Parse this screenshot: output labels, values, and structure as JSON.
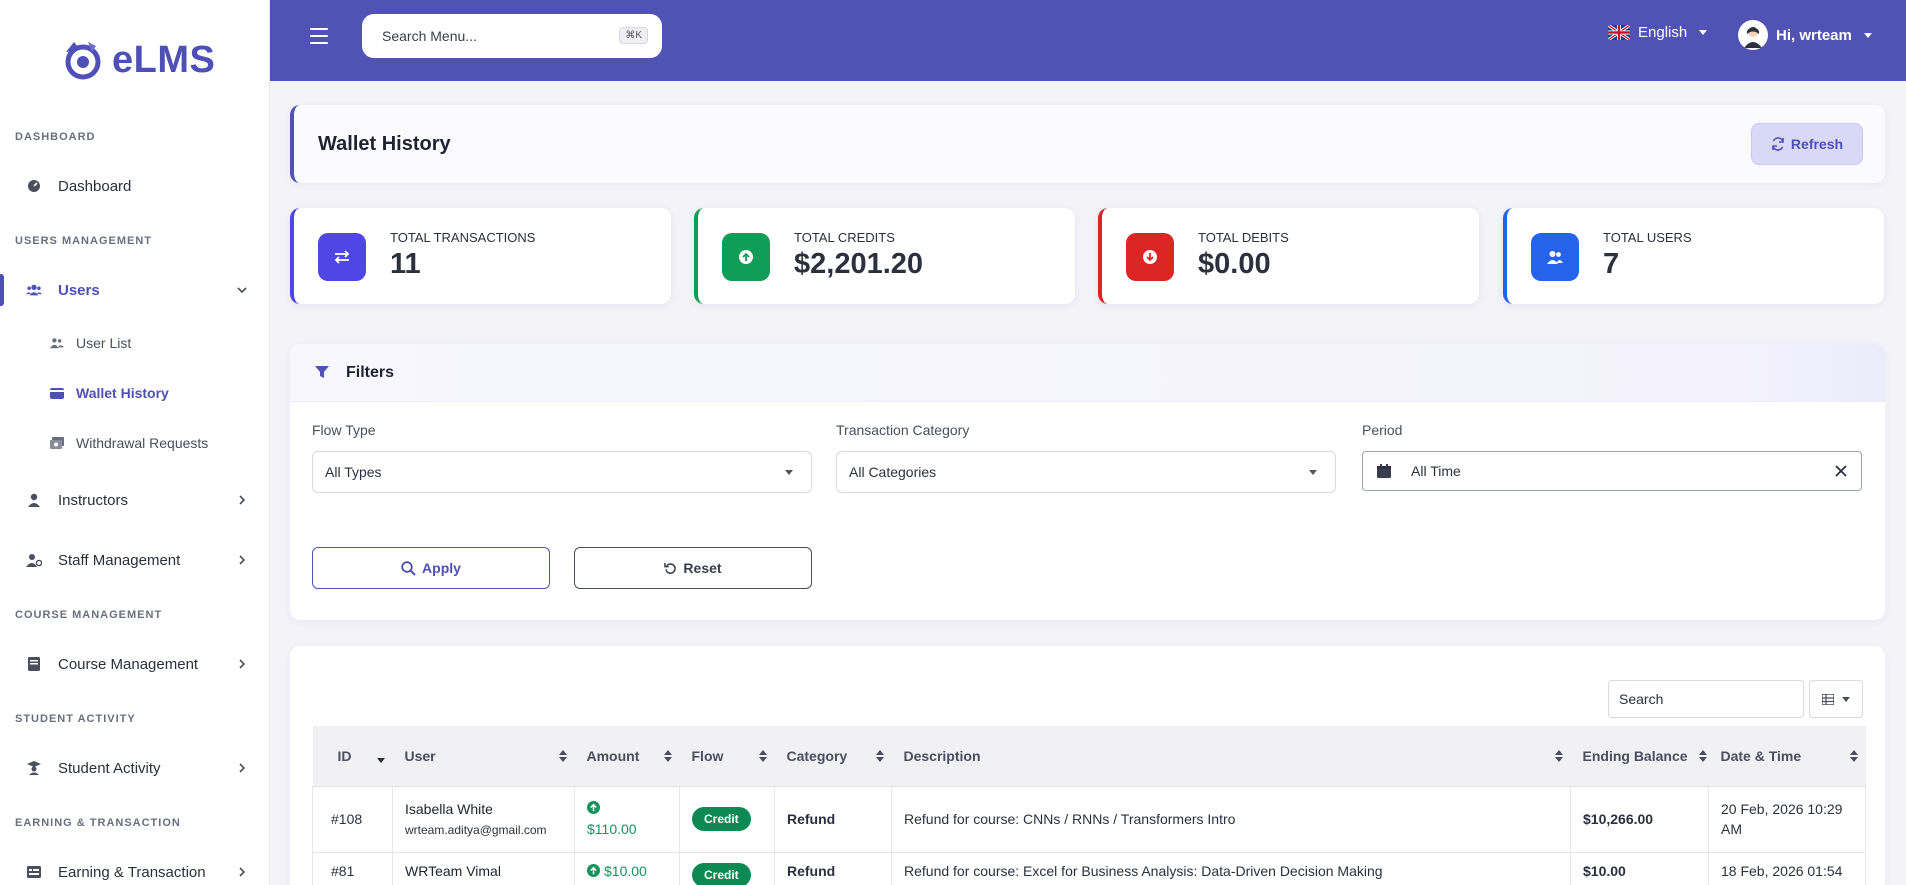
{
  "app": {
    "brand": "eLMS"
  },
  "sidebar": {
    "sections": {
      "dashboard": "DASHBOARD",
      "users_management": "USERS MANAGEMENT",
      "course_management": "COURSE MANAGEMENT",
      "student_activity": "STUDENT ACTIVITY",
      "earning_transaction": "EARNING & TRANSACTION"
    },
    "items": {
      "dashboard": "Dashboard",
      "users": "Users",
      "user_list": "User List",
      "wallet_history": "Wallet History",
      "withdrawal_requests": "Withdrawal Requests",
      "instructors": "Instructors",
      "staff_management": "Staff Management",
      "course_management": "Course Management",
      "student_activity": "Student Activity",
      "earning_transaction": "Earning & Transaction"
    }
  },
  "topbar": {
    "search_placeholder": "Search Menu...",
    "shortcut": "⌘K",
    "language": "English",
    "greeting": "Hi, wrteam"
  },
  "page": {
    "title": "Wallet History",
    "refresh_label": "Refresh"
  },
  "stats": [
    {
      "label": "TOTAL TRANSACTIONS",
      "value": "11",
      "color": "#4f46e5"
    },
    {
      "label": "TOTAL CREDITS",
      "value": "$2,201.20",
      "color": "#0f9d58"
    },
    {
      "label": "TOTAL DEBITS",
      "value": "$0.00",
      "color": "#dc2626"
    },
    {
      "label": "TOTAL USERS",
      "value": "7",
      "color": "#2563eb"
    }
  ],
  "filters": {
    "title": "Filters",
    "flow_type": {
      "label": "Flow Type",
      "value": "All Types"
    },
    "category": {
      "label": "Transaction Category",
      "value": "All Categories"
    },
    "period": {
      "label": "Period",
      "value": "All Time"
    },
    "apply_label": "Apply",
    "reset_label": "Reset"
  },
  "table": {
    "search_placeholder": "Search",
    "columns": [
      "ID",
      "User",
      "Amount",
      "Flow",
      "Category",
      "Description",
      "Ending Balance",
      "Date & Time"
    ],
    "rows": [
      {
        "id": "#108",
        "user_name": "Isabella White",
        "user_email": "wrteam.aditya@gmail.com",
        "amount": "$110.00",
        "flow": "Credit",
        "category": "Refund",
        "description": "Refund for course: CNNs / RNNs / Transformers Intro",
        "ending_balance": "$10,266.00",
        "datetime": "20 Feb, 2026 10:29 AM"
      },
      {
        "id": "#81",
        "user_name": "WRTeam Vimal",
        "user_email": "",
        "amount": "$10.00",
        "flow": "Credit",
        "category": "Refund",
        "description": "Refund for course: Excel for Business Analysis: Data-Driven Decision Making",
        "ending_balance": "$10.00",
        "datetime": "18 Feb, 2026 01:54"
      }
    ]
  },
  "colors": {
    "primary": "#5053b4",
    "credit_green": "#0d8a53"
  }
}
